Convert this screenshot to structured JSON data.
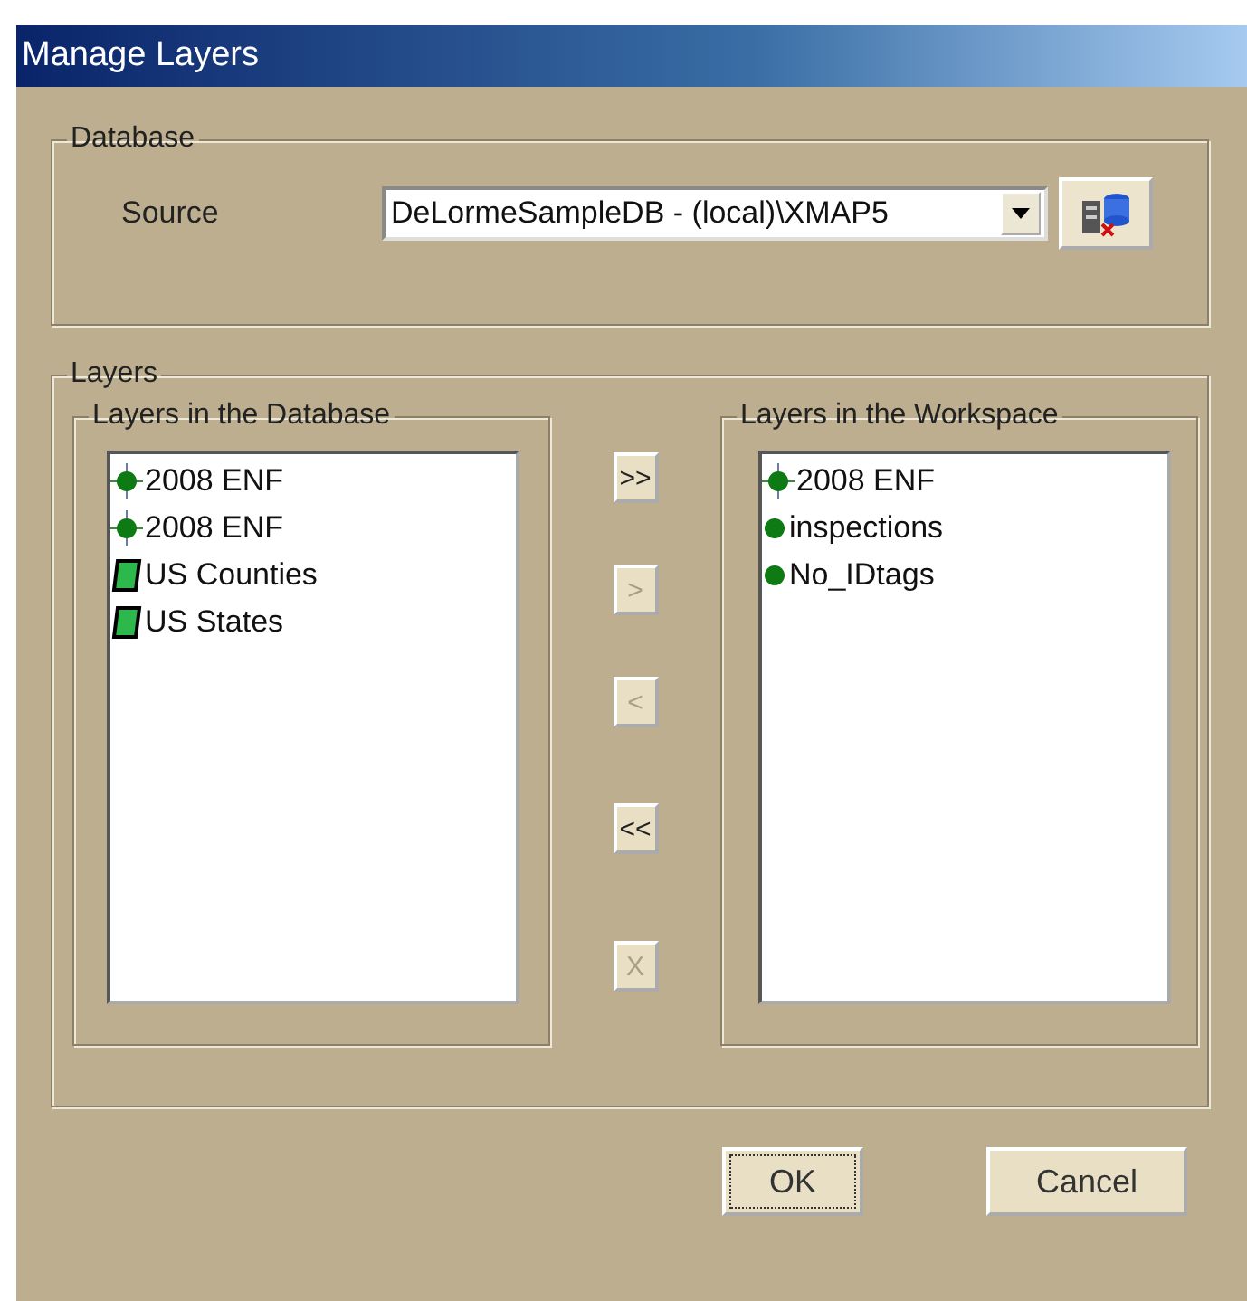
{
  "window": {
    "title": "Manage Layers"
  },
  "database": {
    "legend": "Database",
    "source_label": "Source",
    "source_value": "DeLormeSampleDB - (local)\\XMAP5"
  },
  "layers": {
    "legend": "Layers",
    "database_list": {
      "legend": "Layers in the Database",
      "items": [
        {
          "label": "2008 ENF",
          "kind": "point-target"
        },
        {
          "label": "2008 ENF",
          "kind": "point-target"
        },
        {
          "label": "US Counties",
          "kind": "polygon"
        },
        {
          "label": "US States",
          "kind": "polygon"
        }
      ]
    },
    "transfer_buttons": [
      {
        "label": ">>",
        "disabled": false
      },
      {
        "label": ">",
        "disabled": true
      },
      {
        "label": "<",
        "disabled": true
      },
      {
        "label": "<<",
        "disabled": false
      },
      {
        "label": "X",
        "disabled": true
      }
    ],
    "workspace_list": {
      "legend": "Layers in the Workspace",
      "items": [
        {
          "label": "2008 ENF",
          "kind": "point-target"
        },
        {
          "label": "inspections",
          "kind": "point"
        },
        {
          "label": "No_IDtags",
          "kind": "point"
        }
      ]
    }
  },
  "buttons": [
    {
      "label": "OK",
      "focused": true
    },
    {
      "label": "Cancel",
      "focused": false
    }
  ]
}
